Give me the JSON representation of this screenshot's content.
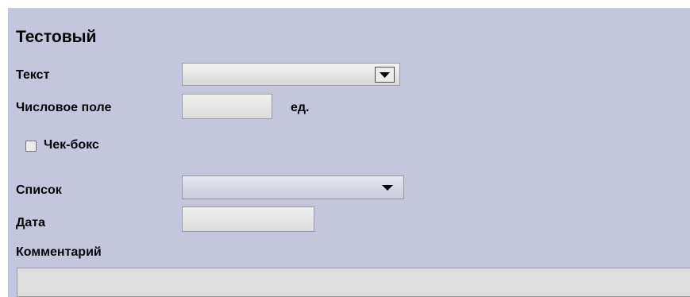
{
  "form": {
    "title": "Тестовый",
    "text_label": "Текст",
    "text_value": "",
    "number_label": "Числовое поле",
    "number_value": "",
    "number_unit": "ед.",
    "checkbox_label": "Чек-бокс",
    "checkbox_checked": false,
    "list_label": "Список",
    "list_value": "",
    "date_label": "Дата",
    "date_value": "",
    "comment_label": "Комментарий",
    "comment_value": ""
  },
  "icons": {
    "dropdown": "chevron-down-icon",
    "checkbox": "checkbox-icon"
  },
  "colors": {
    "panel_background": "#c3c6dd",
    "field_background": "#e6e6e6"
  }
}
